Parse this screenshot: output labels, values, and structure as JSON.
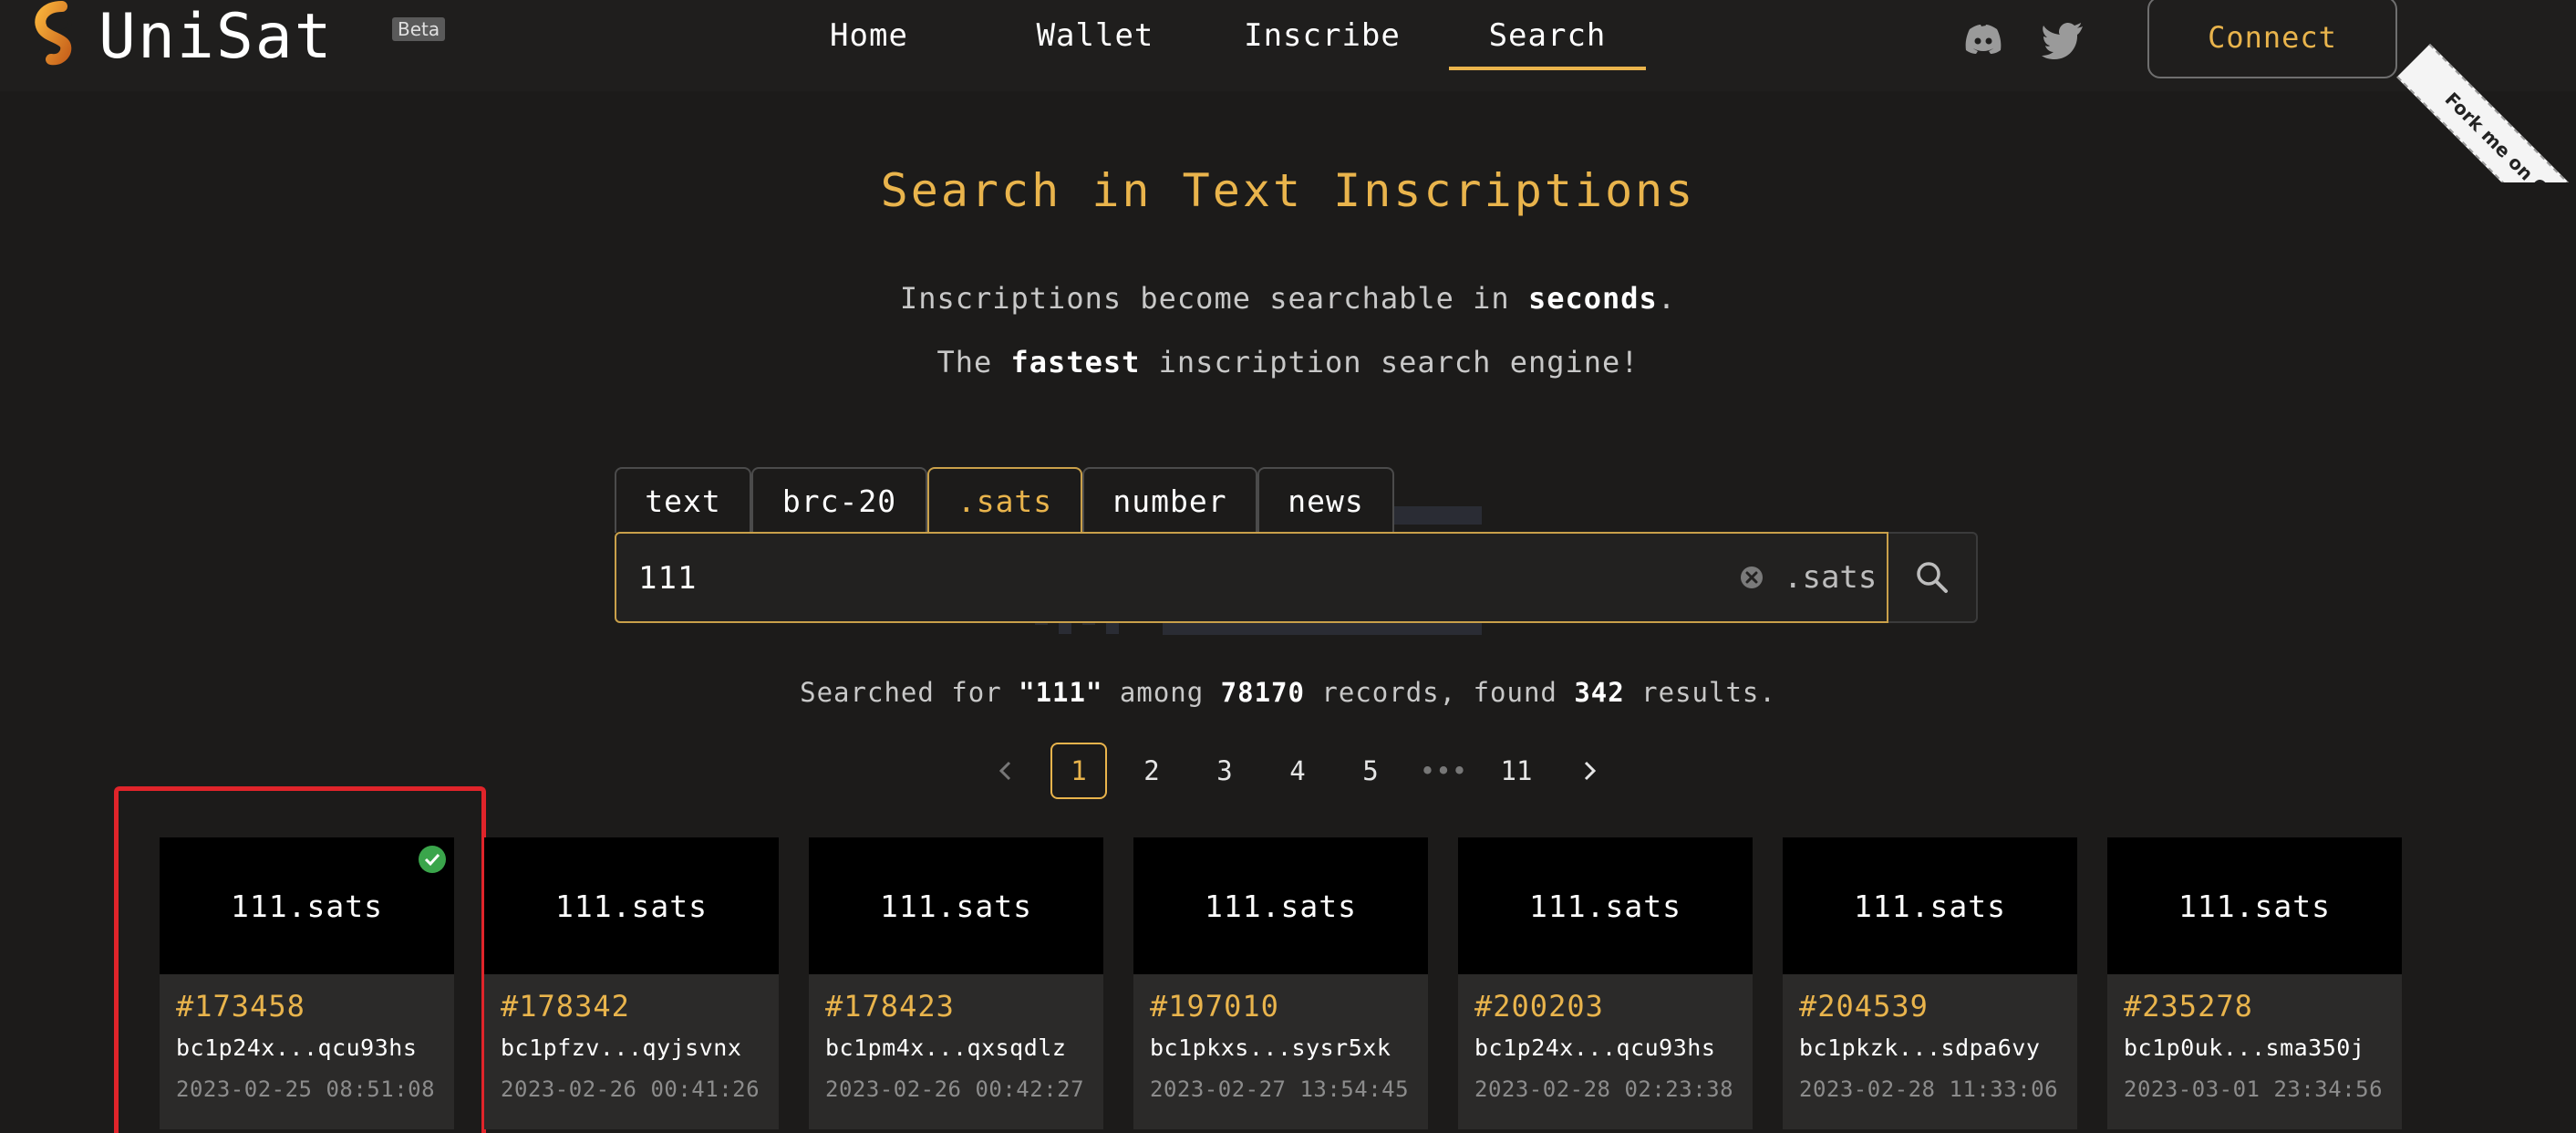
{
  "header": {
    "brand": "UniSat",
    "badge": "Beta",
    "nav": [
      {
        "label": "Home"
      },
      {
        "label": "Wallet"
      },
      {
        "label": "Inscribe"
      },
      {
        "label": "Search",
        "active": true
      }
    ],
    "social": [
      "discord-icon",
      "twitter-icon"
    ],
    "connect_label": "Connect",
    "ribbon": "Fork me on GitHub"
  },
  "hero": {
    "title": "Search in Text Inscriptions",
    "line1_pre": "Inscriptions become searchable in ",
    "line1_bold": "seconds",
    "line1_post": ".",
    "line2_pre": "The ",
    "line2_bold": "fastest",
    "line2_post": " inscription search engine!"
  },
  "search": {
    "tabs": [
      {
        "label": "text"
      },
      {
        "label": "brc-20"
      },
      {
        "label": ".sats",
        "active": true
      },
      {
        "label": "number"
      },
      {
        "label": "news"
      }
    ],
    "value": "111",
    "suffix": ".sats"
  },
  "results": {
    "prefix": "Searched for ",
    "query": "\"111\"",
    "among": " among ",
    "records": "78170",
    "records_label": " records, found ",
    "found": "342",
    "tail": " results."
  },
  "pagination": {
    "pages": [
      "1",
      "2",
      "3",
      "4",
      "5"
    ],
    "ellipsis": "•••",
    "last": "11",
    "current": "1"
  },
  "cards": [
    {
      "title": "111.sats",
      "number": "#173458",
      "address": "bc1p24x...qcu93hs",
      "time": "2023-02-25 08:51:08",
      "verified": true
    },
    {
      "title": "111.sats",
      "number": "#178342",
      "address": "bc1pfzv...qyjsvnx",
      "time": "2023-02-26 00:41:26"
    },
    {
      "title": "111.sats",
      "number": "#178423",
      "address": "bc1pm4x...qxsqdlz",
      "time": "2023-02-26 00:42:27"
    },
    {
      "title": "111.sats",
      "number": "#197010",
      "address": "bc1pkxs...sysr5xk",
      "time": "2023-02-27 13:54:45"
    },
    {
      "title": "111.sats",
      "number": "#200203",
      "address": "bc1p24x...qcu93hs",
      "time": "2023-02-28 02:23:38"
    },
    {
      "title": "111.sats",
      "number": "#204539",
      "address": "bc1pkzk...sdpa6vy",
      "time": "2023-02-28 11:33:06"
    },
    {
      "title": "111.sats",
      "number": "#235278",
      "address": "bc1p0uk...sma350j",
      "time": "2023-03-01 23:34:56"
    }
  ],
  "colors": {
    "accent": "#e9b44c",
    "highlight": "#e0242a",
    "background": "#1c1b1a"
  }
}
